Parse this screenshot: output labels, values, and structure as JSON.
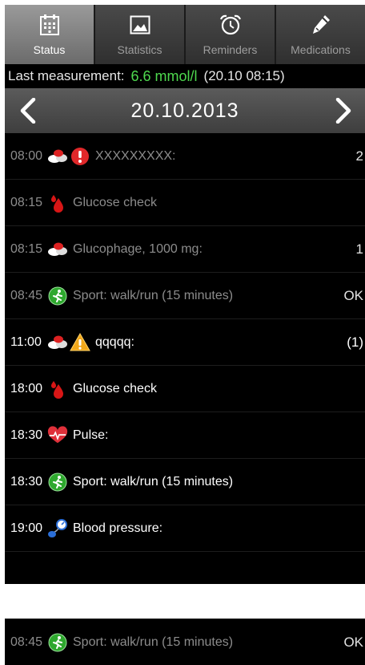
{
  "tabs": [
    {
      "label": "Status",
      "icon": "calendar-icon",
      "active": true
    },
    {
      "label": "Statistics",
      "icon": "picture-icon",
      "active": false
    },
    {
      "label": "Reminders",
      "icon": "alarm-clock-icon",
      "active": false
    },
    {
      "label": "Medications",
      "icon": "pencil-icon",
      "active": false
    }
  ],
  "last_measurement": {
    "label": "Last measurement:",
    "value": "6.6 mmol/l",
    "time": "(20.10 08:15)"
  },
  "date_nav": {
    "date": "20.10.2013",
    "prev_icon": "chevron-left-icon",
    "next_icon": "chevron-right-icon"
  },
  "entries": [
    {
      "time": "08:00",
      "icons": [
        "pills-icon",
        "warning-red-icon"
      ],
      "text": "XXXXXXXXX:",
      "value": "2",
      "state": "past"
    },
    {
      "time": "08:15",
      "icons": [
        "blood-drop-icon"
      ],
      "text": "Glucose check",
      "value": "",
      "state": "past"
    },
    {
      "time": "08:15",
      "icons": [
        "pills-icon"
      ],
      "text": "Glucophage, 1000 mg:",
      "value": "1",
      "state": "past"
    },
    {
      "time": "08:45",
      "icons": [
        "sport-run-icon"
      ],
      "text": "Sport: walk/run (15 minutes)",
      "value": "OK",
      "state": "past"
    },
    {
      "time": "11:00",
      "icons": [
        "pills-icon",
        "warning-triangle-icon"
      ],
      "text": "qqqqq:",
      "value": "(1)",
      "state": "future"
    },
    {
      "time": "18:00",
      "icons": [
        "blood-drop-icon"
      ],
      "text": "Glucose check",
      "value": "",
      "state": "future"
    },
    {
      "time": "18:30",
      "icons": [
        "heart-pulse-icon"
      ],
      "text": "Pulse:",
      "value": "",
      "state": "future"
    },
    {
      "time": "18:30",
      "icons": [
        "sport-run-icon"
      ],
      "text": "Sport: walk/run (15 minutes)",
      "value": "",
      "state": "future"
    },
    {
      "time": "19:00",
      "icons": [
        "blood-pressure-icon"
      ],
      "text": "Blood pressure:",
      "value": "",
      "state": "future"
    }
  ],
  "fragment_entry": {
    "time": "08:45",
    "icons": [
      "sport-run-icon"
    ],
    "text": "Sport: walk/run (15 minutes)",
    "value": "OK",
    "state": "past"
  },
  "colors": {
    "accent_green": "#4ed84e",
    "background": "#000000",
    "tab_active": "#8a8a8a"
  }
}
